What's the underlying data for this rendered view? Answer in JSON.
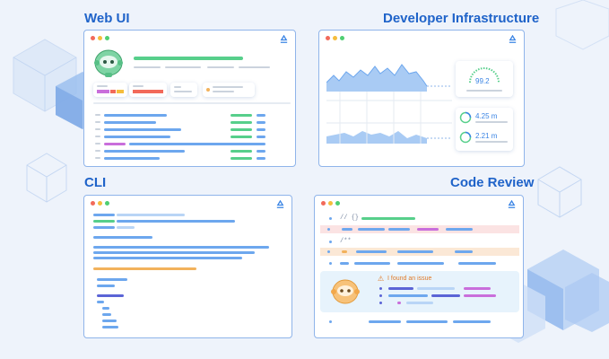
{
  "sections": {
    "web_ui": "Web UI",
    "dev_infra": "Developer Infrastructure",
    "cli": "CLI",
    "code_review": "Code Review"
  },
  "colors": {
    "accent": "#1f63c9",
    "window_border": "#8fb4ea",
    "dot_red": "#f26a5a",
    "dot_yellow": "#f5bd3c",
    "dot_green": "#4fcf72",
    "mascot_green": "#7ed4a4",
    "mascot_orange": "#f7c27a",
    "issue_bg": "#e7f3fc"
  },
  "dev_infra": {
    "gauge_value": "99.2",
    "metric_1": "4.25 m",
    "metric_2": "2.21 m"
  },
  "code_review": {
    "line_1": "// {}",
    "line_2": "/**",
    "issue_text": "I found an issue"
  },
  "icons": [
    "recycle-logo-icon",
    "robot-mascot-icon",
    "warning-icon"
  ]
}
